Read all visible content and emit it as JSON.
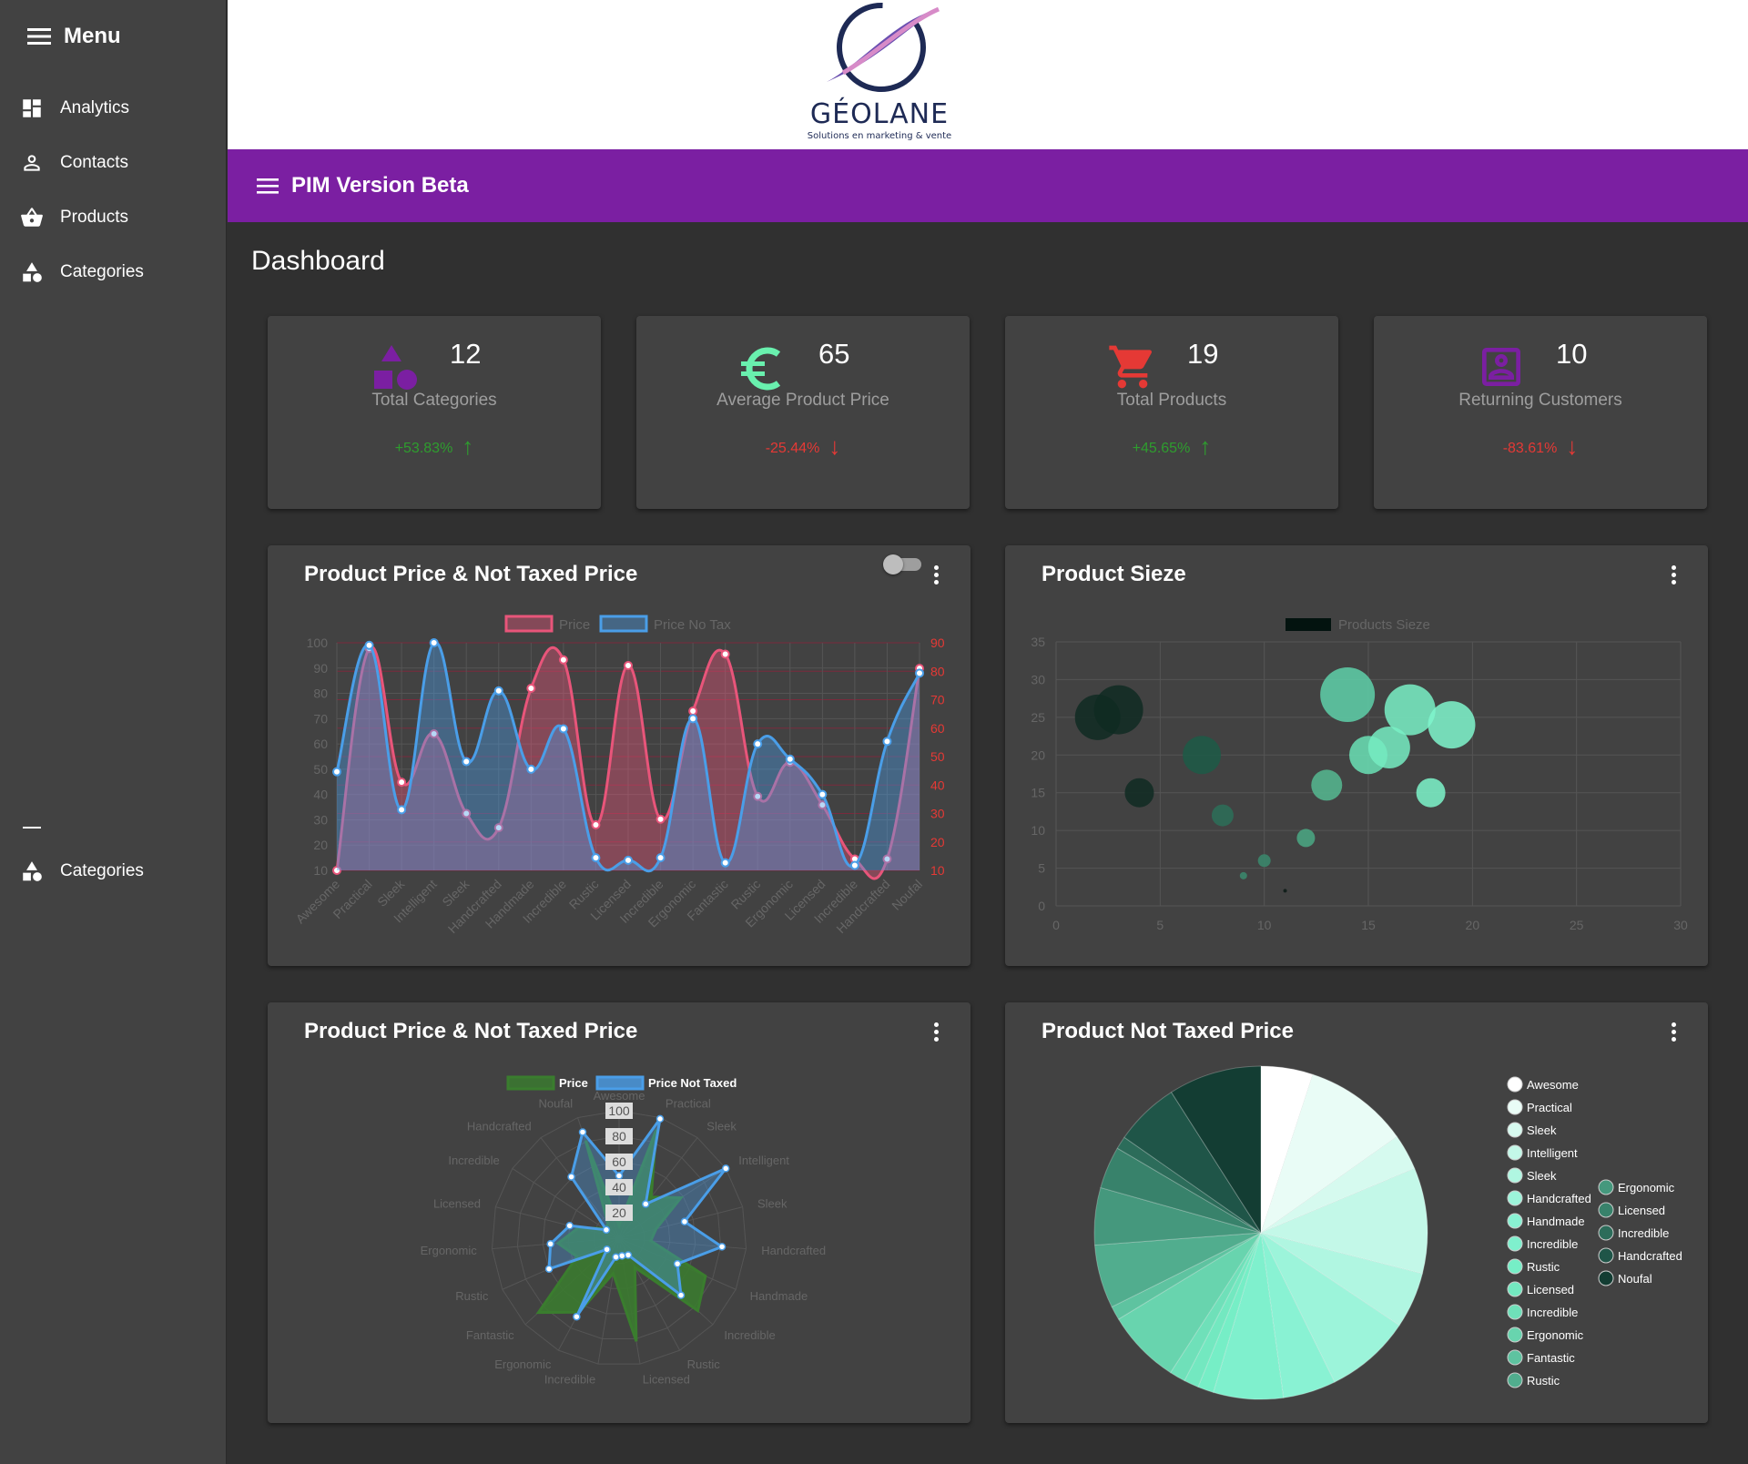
{
  "sidebar": {
    "title": "Menu",
    "items": [
      {
        "label": "Analytics",
        "icon": "dashboard-icon"
      },
      {
        "label": "Contacts",
        "icon": "person-icon"
      },
      {
        "label": "Products",
        "icon": "basket-icon"
      },
      {
        "label": "Categories",
        "icon": "shapes-icon"
      }
    ],
    "section2": {
      "dash": "—",
      "items": [
        {
          "label": "Categories",
          "icon": "shapes-icon"
        }
      ]
    }
  },
  "logo": {
    "word": "GÉOLANE",
    "tagline": "Solutions en marketing & vente"
  },
  "topbar": {
    "title": "PIM Version Beta"
  },
  "page": {
    "title": "Dashboard"
  },
  "stats": [
    {
      "value": "12",
      "label": "Total Categories",
      "change": "+53.83%",
      "trend": "up",
      "icon": "shapes-icon",
      "color": "#7b1fa2"
    },
    {
      "value": "65",
      "label": "Average Product Price",
      "change": "-25.44%",
      "trend": "down",
      "icon": "euro-icon",
      "color": "#69f0ae"
    },
    {
      "value": "19",
      "label": "Total Products",
      "change": "+45.65%",
      "trend": "up",
      "icon": "cart-icon",
      "color": "#e53935"
    },
    {
      "value": "10",
      "label": "Returning Customers",
      "change": "-83.61%",
      "trend": "down",
      "icon": "account-box-icon",
      "color": "#7b1fa2"
    }
  ],
  "charts": {
    "line_title": "Product Price & Not Taxed Price",
    "bubble_title": "Product Sieze",
    "radar_title": "Product Price & Not Taxed Price",
    "pie_title": "Product Not Taxed Price"
  },
  "chart_data": [
    {
      "type": "line",
      "categories": [
        "Awesome",
        "Practical",
        "Sleek",
        "Intelligent",
        "Sleek",
        "Handcrafted",
        "Handmade",
        "Incredible",
        "Rustic",
        "Licensed",
        "Incredible",
        "Ergonomic",
        "Fantastic",
        "Rustic",
        "Ergonomic",
        "Licensed",
        "Incredible",
        "Handcrafted",
        "Noufal"
      ],
      "series": [
        {
          "name": "Price",
          "color": "#e8557a",
          "axis": "right",
          "values": [
            10,
            88,
            41,
            58,
            30,
            25,
            74,
            84,
            26,
            82,
            28,
            66,
            86,
            36,
            48,
            33,
            14,
            14,
            81
          ]
        },
        {
          "name": "Price No Tax",
          "color": "#4a9ee8",
          "axis": "left",
          "values": [
            49,
            99,
            34,
            100,
            53,
            81,
            50,
            66,
            15,
            14,
            15,
            70,
            13,
            60,
            54,
            40,
            12,
            61,
            88
          ]
        }
      ],
      "ylim_left": [
        10,
        100
      ],
      "ylim_right": [
        10,
        90
      ],
      "yticks_left": [
        10,
        20,
        30,
        40,
        50,
        60,
        70,
        80,
        90,
        100
      ],
      "yticks_right": [
        10,
        20,
        30,
        40,
        50,
        60,
        70,
        80,
        90
      ],
      "grid": true,
      "legend": "top"
    },
    {
      "type": "scatter",
      "series": [
        {
          "name": "Products Sieze",
          "color": "#03130f"
        }
      ],
      "points": [
        {
          "x": 2,
          "y": 25,
          "r": 25
        },
        {
          "x": 3,
          "y": 26,
          "r": 27
        },
        {
          "x": 4,
          "y": 15,
          "r": 16
        },
        {
          "x": 7,
          "y": 20,
          "r": 21
        },
        {
          "x": 8,
          "y": 12,
          "r": 12
        },
        {
          "x": 9,
          "y": 4,
          "r": 4
        },
        {
          "x": 10,
          "y": 6,
          "r": 7
        },
        {
          "x": 11,
          "y": 2,
          "r": 2
        },
        {
          "x": 12,
          "y": 9,
          "r": 10
        },
        {
          "x": 13,
          "y": 16,
          "r": 17
        },
        {
          "x": 14,
          "y": 28,
          "r": 30
        },
        {
          "x": 15,
          "y": 20,
          "r": 21
        },
        {
          "x": 16,
          "y": 21,
          "r": 23
        },
        {
          "x": 17,
          "y": 26,
          "r": 28
        },
        {
          "x": 18,
          "y": 15,
          "r": 16
        },
        {
          "x": 19,
          "y": 24,
          "r": 26
        }
      ],
      "xlim": [
        0,
        30
      ],
      "ylim": [
        0,
        35
      ],
      "xticks": [
        0,
        5,
        10,
        15,
        20,
        25,
        30
      ],
      "yticks": [
        0,
        5,
        10,
        15,
        20,
        25,
        30,
        35
      ],
      "grid": true,
      "legend": "top"
    },
    {
      "type": "radar",
      "labels": [
        "Awesome",
        "Practical",
        "Sleek",
        "Intelligent",
        "Sleek",
        "Handcrafted",
        "Handmade",
        "Incredible",
        "Rustic",
        "Licensed",
        "Incredible",
        "Ergonomic",
        "Fantastic",
        "Rustic",
        "Ergonomic",
        "Licensed",
        "Incredible",
        "Handcrafted",
        "Noufal"
      ],
      "series": [
        {
          "name": "Price",
          "color": "#3a7d2e",
          "values": [
            10,
            90,
            41,
            58,
            30,
            25,
            74,
            84,
            26,
            82,
            28,
            66,
            86,
            36,
            48,
            33,
            14,
            14,
            81
          ]
        },
        {
          "name": "Price Not Taxed",
          "color": "#4a9ee8",
          "values": [
            49,
            99,
            34,
            100,
            53,
            81,
            50,
            66,
            15,
            14,
            15,
            70,
            13,
            60,
            54,
            40,
            12,
            61,
            88
          ]
        }
      ],
      "rlim": [
        0,
        100
      ],
      "ticks": [
        20,
        40,
        60,
        80,
        100
      ],
      "legend": "top"
    },
    {
      "type": "pie",
      "labels": [
        "Awesome",
        "Practical",
        "Sleek",
        "Intelligent",
        "Sleek",
        "Handcrafted",
        "Handmade",
        "Incredible",
        "Rustic",
        "Licensed",
        "Incredible",
        "Ergonomic",
        "Fantastic",
        "Rustic",
        "Ergonomic",
        "Licensed",
        "Incredible",
        "Handcrafted",
        "Noufal"
      ],
      "values": [
        49,
        99,
        34,
        100,
        53,
        81,
        50,
        66,
        15,
        14,
        15,
        70,
        13,
        60,
        54,
        40,
        12,
        61,
        88
      ],
      "colors": [
        "#ffffff",
        "#e9fcf6",
        "#d6faef",
        "#c3f8e8",
        "#b0f6e1",
        "#9cf4da",
        "#89f2d3",
        "#7ff0cd",
        "#76eec6",
        "#73e8c0",
        "#6fe0b9",
        "#68d4ae",
        "#5ec3a0",
        "#51ad8e",
        "#45987d",
        "#38826b",
        "#2c6c5a",
        "#1f5548",
        "#133d33"
      ],
      "legend": "right"
    }
  ]
}
